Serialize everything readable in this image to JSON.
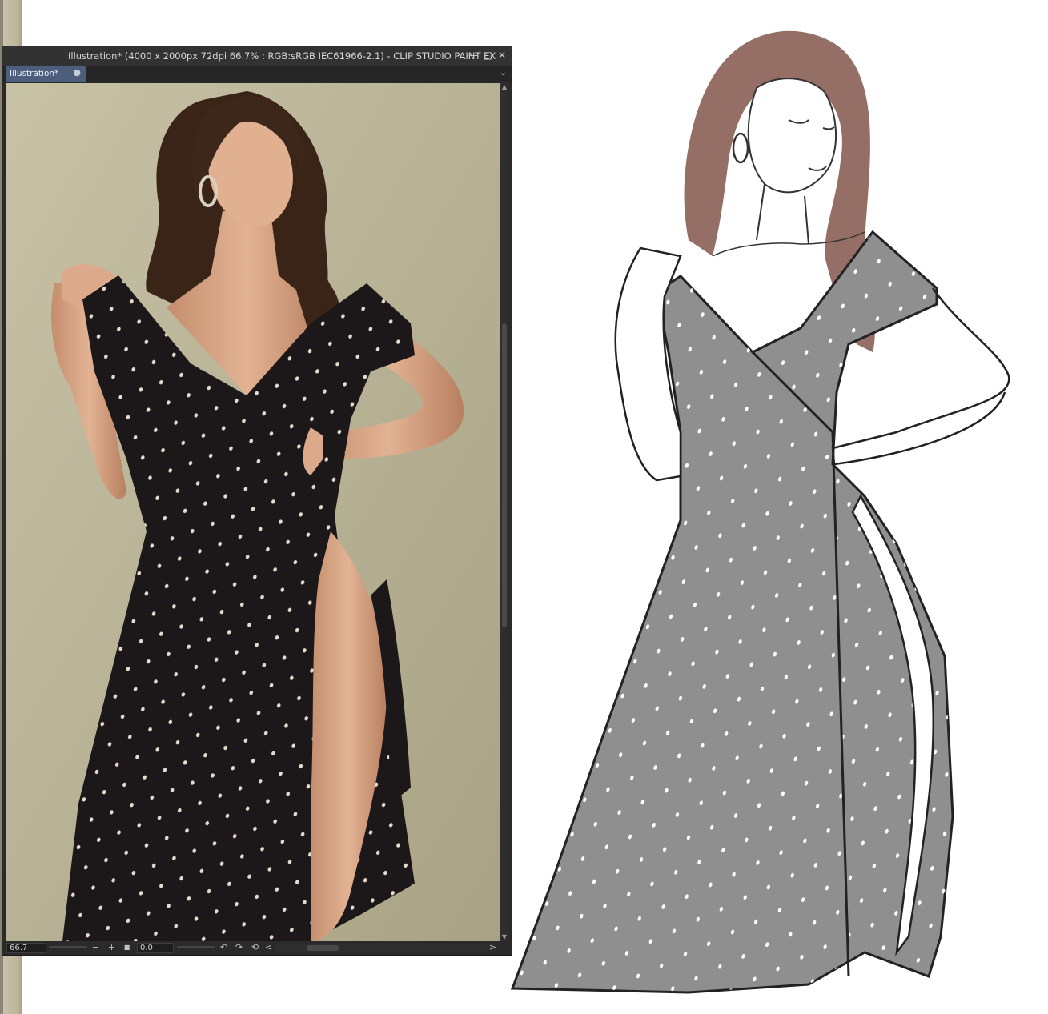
{
  "window": {
    "title": "Illustration* (4000 x 2000px 72dpi 66.7% : RGB:sRGB IEC61966-2.1)  - CLIP STUDIO PAINT EX",
    "minimize_glyph": "—",
    "maximize_glyph": "□",
    "close_glyph": "✕"
  },
  "tabs": [
    {
      "label": "Illustration*",
      "close_glyph": "●",
      "active": true
    }
  ],
  "tab_menu_glyph": "⌄",
  "statusbar": {
    "zoom_value": "66.7",
    "zoom_out_glyph": "−",
    "zoom_in_glyph": "+",
    "fit_glyph": "■",
    "angle_value": "0.0",
    "rotate_left_glyph": "↶",
    "rotate_right_glyph": "↷",
    "reset_glyph": "⟲",
    "scroll_left_glyph": "<",
    "scroll_right_glyph": ">"
  },
  "colors": {
    "ui_dark": "#2b2b2b",
    "tab_active": "#4d5d7c",
    "photo_backdrop": "#b8b295",
    "dress": "#1c1718",
    "skin": "#d9a888",
    "hair": "#3a2418",
    "sketch_hair": "#8a5f55",
    "sketch_dress": "#8f8f8f"
  }
}
